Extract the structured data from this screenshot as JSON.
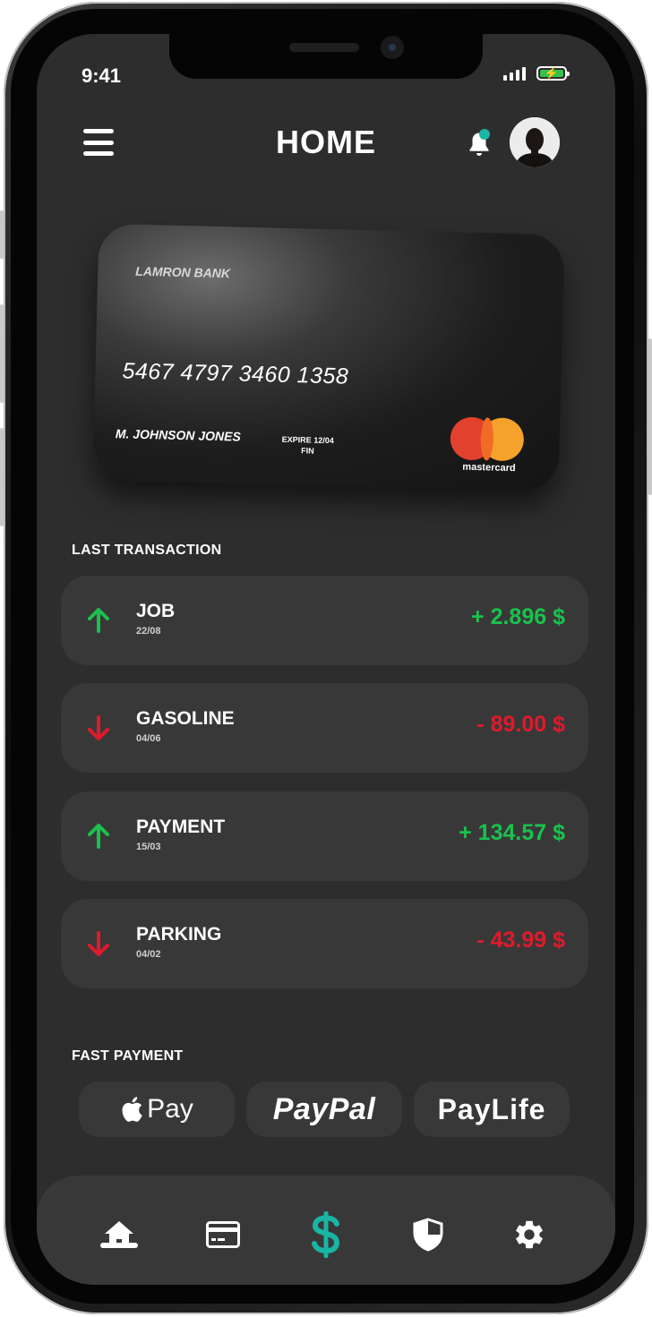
{
  "status": {
    "time": "9:41"
  },
  "header": {
    "title": "HOME"
  },
  "card": {
    "bank": "LAMRON BANK",
    "number": "5467 4797 3460 1358",
    "holder": "M. JOHNSON JONES",
    "expire_label": "EXPIRE",
    "expire_value": "12/04",
    "fin_label": "FIN",
    "brand": "mastercard"
  },
  "transactions": {
    "label": "LAST TRANSACTION",
    "items": [
      {
        "name": "JOB",
        "date": "22/08",
        "amount": "+ 2.896 $",
        "direction": "up"
      },
      {
        "name": "GASOLINE",
        "date": "04/06",
        "amount": "- 89.00 $",
        "direction": "down"
      },
      {
        "name": "PAYMENT",
        "date": "15/03",
        "amount": "+ 134.57 $",
        "direction": "up"
      },
      {
        "name": "PARKING",
        "date": "04/02",
        "amount": "- 43.99 $",
        "direction": "down"
      }
    ]
  },
  "fast_payment": {
    "label": "FAST PAYMENT",
    "apple_pay": "Pay",
    "paypal": "PayPal",
    "paylife": "PayLife"
  },
  "colors": {
    "positive": "#19c24d",
    "negative": "#e01a2a",
    "accent": "#19b5a5",
    "battery": "#33c24a"
  },
  "tabs": [
    "home-icon",
    "card-icon",
    "dollar-icon",
    "shield-icon",
    "gear-icon"
  ]
}
